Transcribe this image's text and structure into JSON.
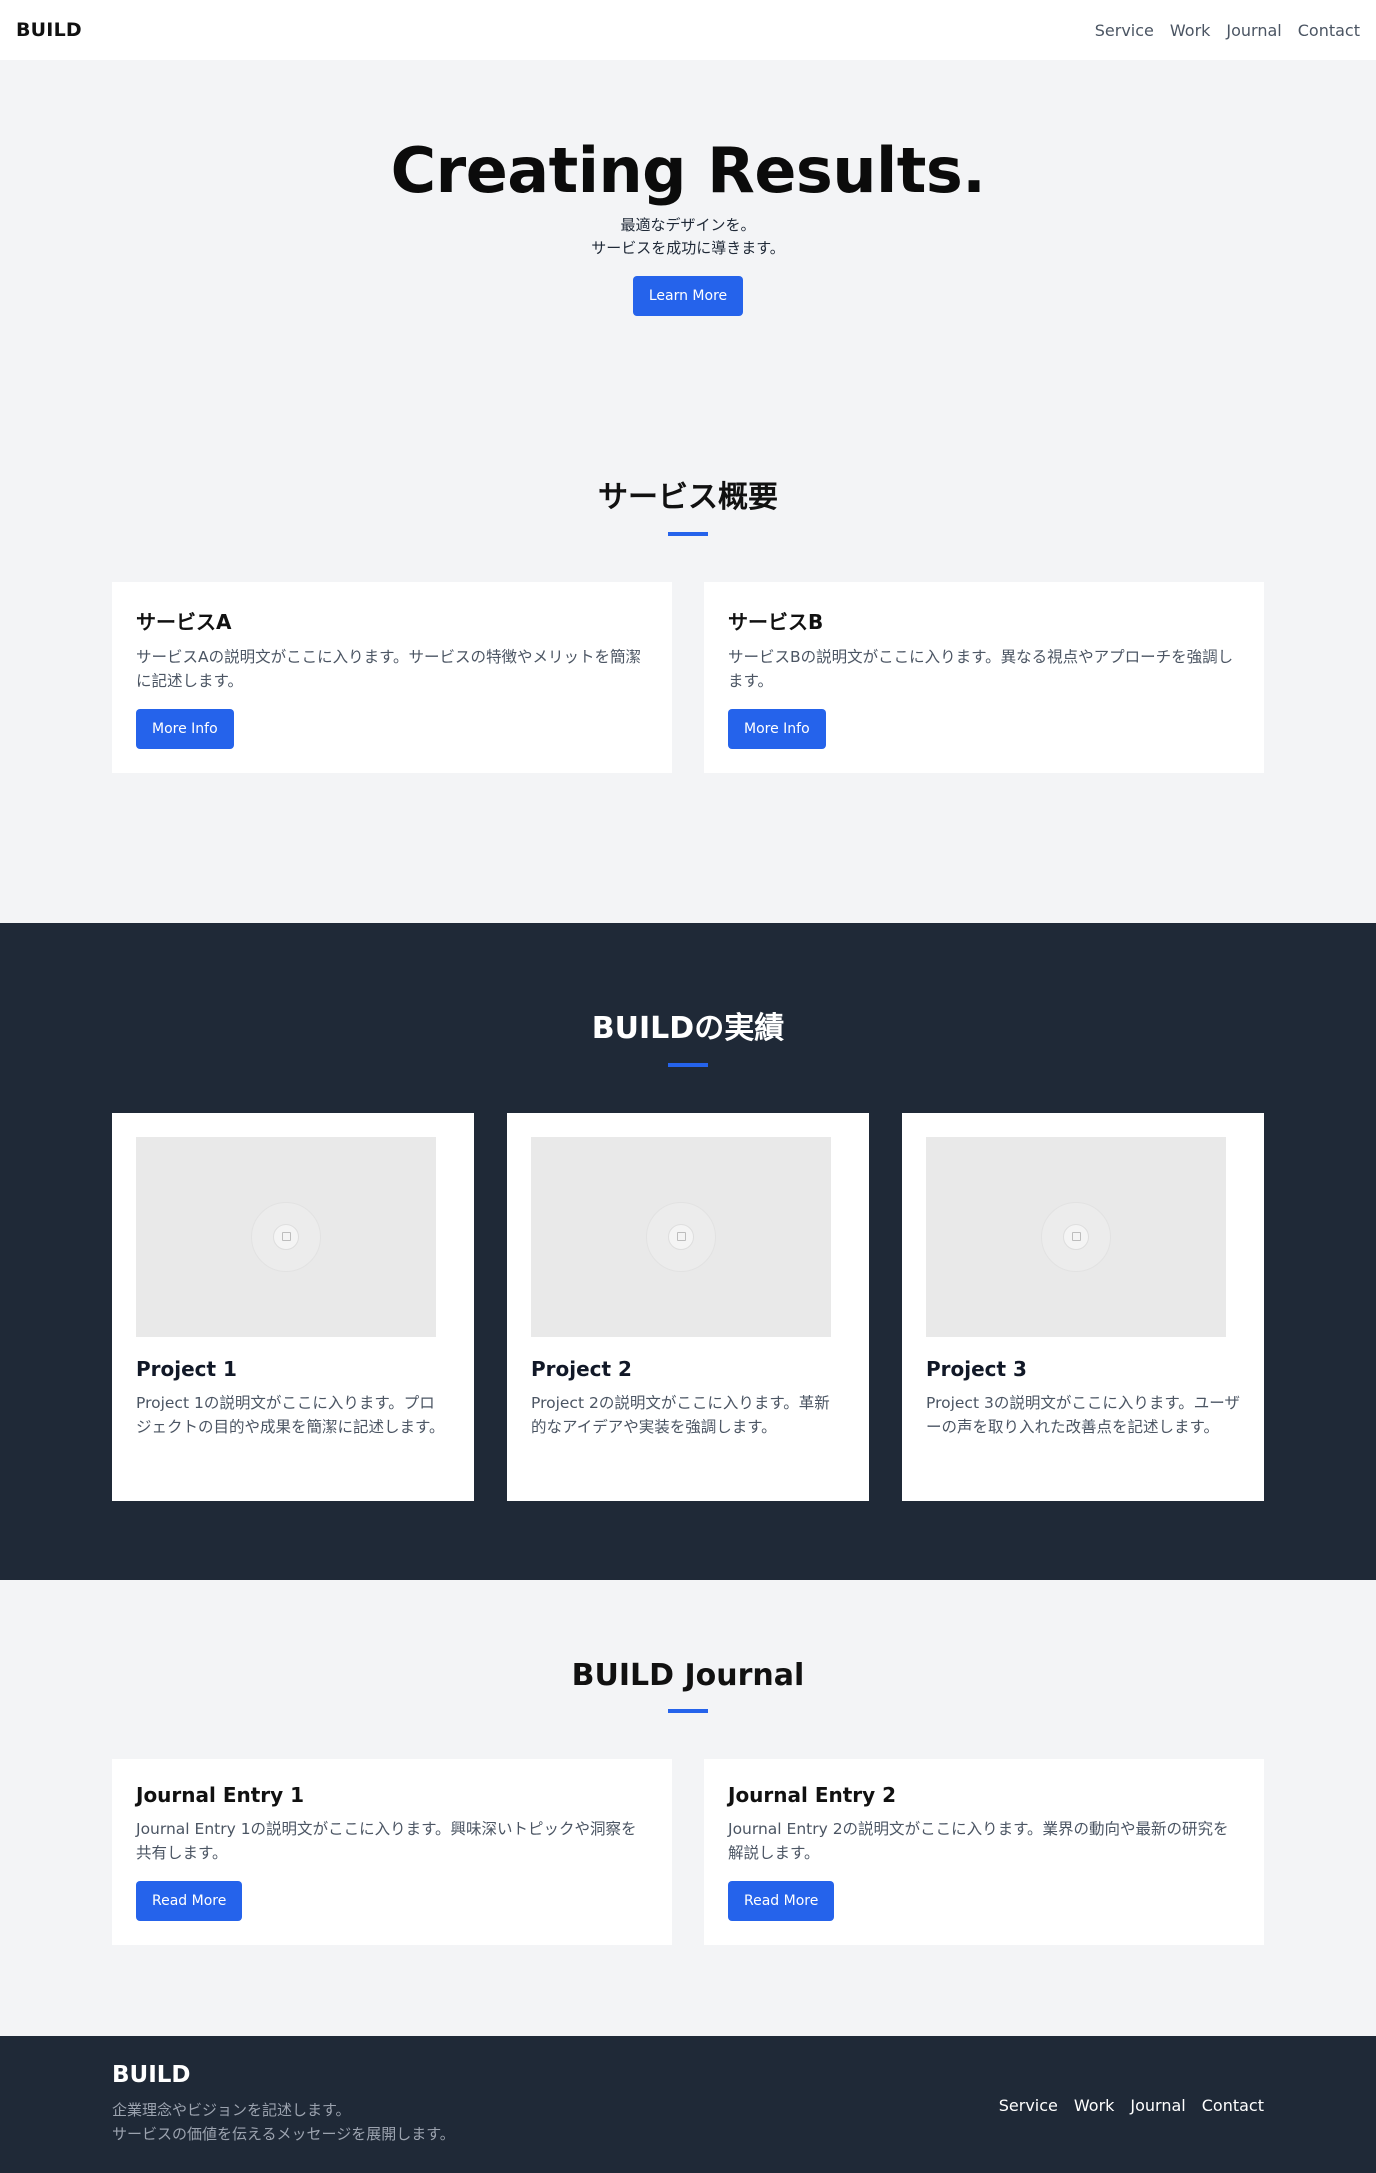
{
  "header": {
    "logo": "BUILD",
    "nav": [
      "Service",
      "Work",
      "Journal",
      "Contact"
    ]
  },
  "hero": {
    "title": "Creating Results.",
    "subtitle_line1": "最適なデザインを。",
    "subtitle_line2": "サービスを成功に導きます。",
    "cta": "Learn More"
  },
  "services": {
    "title": "サービス概要",
    "cards": [
      {
        "title": "サービスA",
        "text": "サービスAの説明文がここに入ります。サービスの特徴やメリットを簡潔に記述します。",
        "button": "More Info"
      },
      {
        "title": "サービスB",
        "text": "サービスBの説明文がここに入ります。異なる視点やアプローチを強調します。",
        "button": "More Info"
      }
    ]
  },
  "work": {
    "title": "BUILDの実績",
    "projects": [
      {
        "title": "Project 1",
        "text": "Project 1の説明文がここに入ります。プロジェクトの目的や成果を簡潔に記述します。",
        "image": "image-placeholder-icon"
      },
      {
        "title": "Project 2",
        "text": "Project 2の説明文がここに入ります。革新的なアイデアや実装を強調します。",
        "image": "image-placeholder-icon"
      },
      {
        "title": "Project 3",
        "text": "Project 3の説明文がここに入ります。ユーザーの声を取り入れた改善点を記述します。",
        "image": "image-placeholder-icon"
      }
    ]
  },
  "journal": {
    "title": "BUILD Journal",
    "entries": [
      {
        "title": "Journal Entry 1",
        "text": "Journal Entry 1の説明文がここに入ります。興味深いトピックや洞察を共有します。",
        "button": "Read More"
      },
      {
        "title": "Journal Entry 2",
        "text": "Journal Entry 2の説明文がここに入ります。業界の動向や最新の研究を解説します。",
        "button": "Read More"
      }
    ]
  },
  "footer": {
    "logo": "BUILD",
    "desc_line1": "企業理念やビジョンを記述します。",
    "desc_line2": "サービスの価値を伝えるメッセージを展開します。",
    "nav": [
      "Service",
      "Work",
      "Journal",
      "Contact"
    ]
  },
  "colors": {
    "accent": "#2563eb",
    "dark": "#1f2937",
    "light_bg": "#f3f4f6"
  }
}
